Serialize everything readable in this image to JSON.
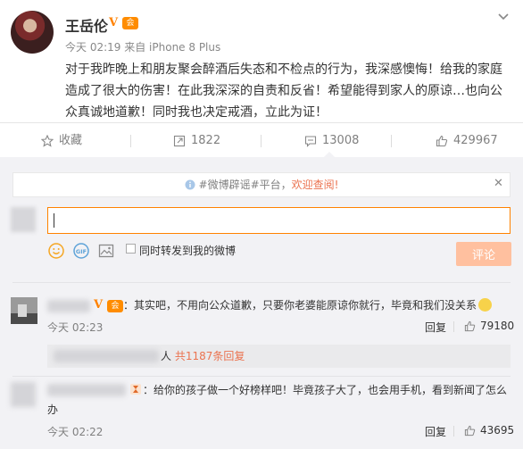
{
  "post": {
    "author": "王岳伦",
    "verified_mark": "V",
    "vip_mark": "会",
    "time": "今天 02:19",
    "source": "来自 iPhone 8 Plus",
    "text": "对于我昨晚上和朋友聚会醉酒后失态和不检点的行为，我深感懊悔！给我的家庭造成了很大的伤害！在此我深深的自责和反省！希望能得到家人的原谅…也向公众真诚地道歉！同时我也决定戒酒，立此为证！"
  },
  "actions": {
    "favorite": "收藏",
    "repost": "1822",
    "comment": "13008",
    "like": "429967"
  },
  "notice": {
    "prefix": "#微博辟谣#平台，",
    "link": "欢迎查阅!"
  },
  "composer": {
    "input_value": "",
    "repost_label": "同时转发到我的微博",
    "submit": "评论"
  },
  "comments": [
    {
      "text": "：其实吧，不用向公众道歉，只要你老婆能原谅你就行，毕竟和我们没关系",
      "time": "今天 02:23",
      "reply": "回复",
      "likes": "79180",
      "reply_suffix": "人",
      "reply_count": "共1187条回复"
    },
    {
      "text": "：给你的孩子做一个好榜样吧！毕竟孩子大了，也会用手机，看到新闻了怎么办",
      "time": "今天 02:22",
      "reply": "回复",
      "likes": "43695"
    }
  ],
  "colors": {
    "accent": "#ff8200",
    "link": "#eb7350",
    "panel_bg": "#f2f2f5"
  }
}
